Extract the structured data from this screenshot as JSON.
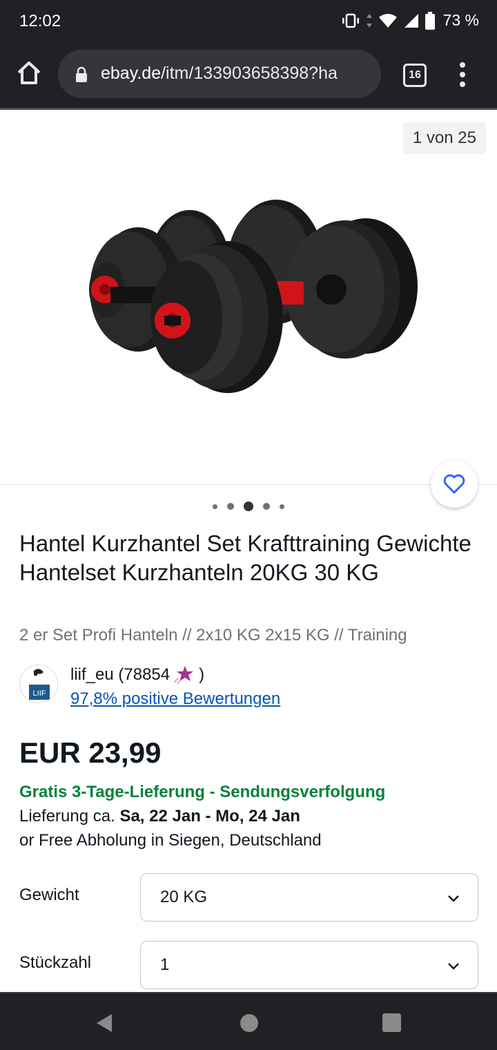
{
  "status_bar": {
    "time": "12:02",
    "battery": "73 %"
  },
  "browser": {
    "url_host": "ebay.de",
    "url_path": "/itm/133903658398?ha",
    "tab_count": "16"
  },
  "gallery": {
    "counter": "1 von 25",
    "dot_count": 5,
    "active_dot": 2
  },
  "listing": {
    "title": "Hantel Kurzhantel Set Krafttraining Gewichte Hantelset Kurzhanteln 20KG 30 KG",
    "subtitle": "2 er Set Profi Hanteln //  2x10 KG 2x15 KG // Training",
    "seller_name_prefix": "liif_eu (78854",
    "seller_name_suffix": ")",
    "seller_logo_text": "LIIF",
    "seller_feedback": "97,8% positive Bewertungen",
    "price": "EUR 23,99",
    "shipping": "Gratis 3-Tage-Lieferung - Sendungsverfolgung",
    "delivery_prefix": "Lieferung ca. ",
    "delivery_dates": "Sa, 22 Jan - Mo, 24 Jan",
    "pickup": "or Free Abholung in Siegen, Deutschland"
  },
  "variations": [
    {
      "label": "Gewicht",
      "value": "20 KG"
    },
    {
      "label": "Stückzahl",
      "value": "1"
    }
  ],
  "colors": {
    "shipping_green": "#05823f",
    "link_blue": "#0654ba",
    "heart_blue": "#3665f3",
    "chrome_dark": "#202124"
  }
}
